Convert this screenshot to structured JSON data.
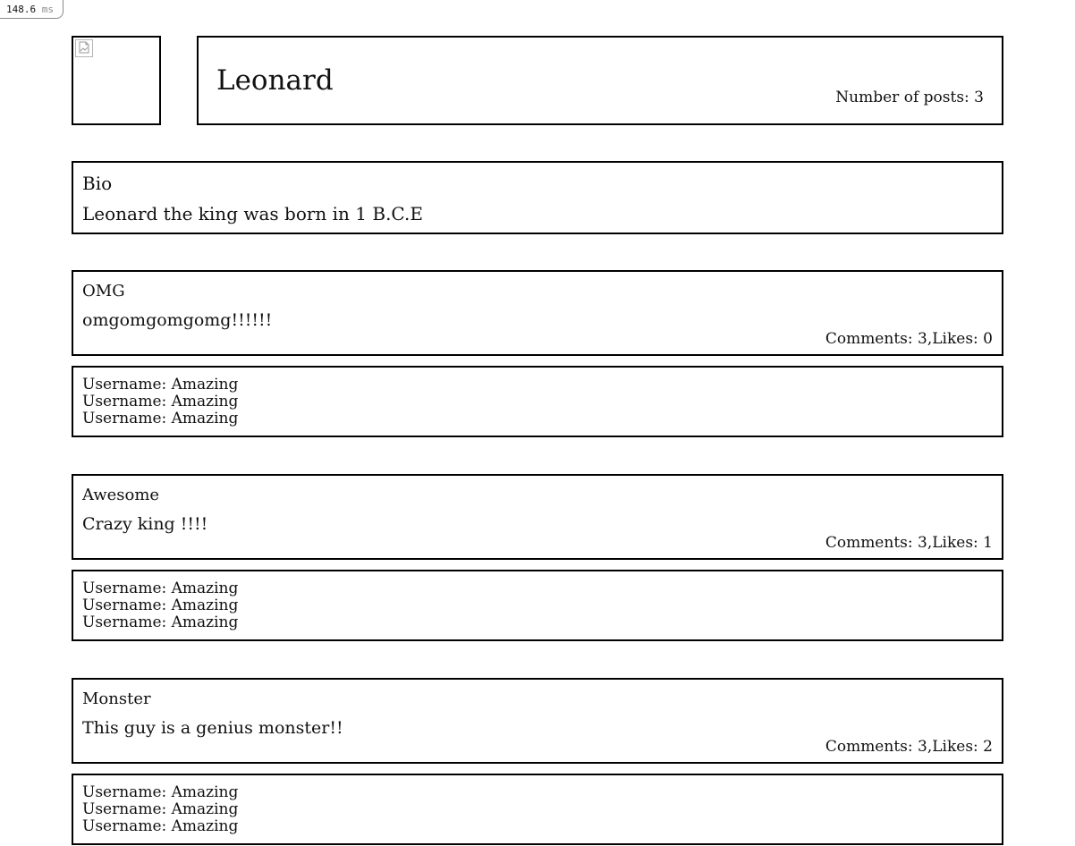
{
  "timing": {
    "value": "148.6",
    "unit": "ms"
  },
  "profile": {
    "avatar_icon": "broken-image-icon",
    "username": "Leonard",
    "post_count_label": "Number of posts: 3"
  },
  "bio": {
    "title": "Bio",
    "text": "Leonard the king was born in 1 B.C.E"
  },
  "posts": [
    {
      "title": "OMG",
      "body": "omgomgomgomg!!!!!!",
      "stats": "Comments: 3,Likes: 0",
      "comments": [
        "Username: Amazing",
        "Username: Amazing",
        "Username: Amazing"
      ]
    },
    {
      "title": "Awesome",
      "body": "Crazy king !!!!",
      "stats": "Comments: 3,Likes: 1",
      "comments": [
        "Username: Amazing",
        "Username: Amazing",
        "Username: Amazing"
      ]
    },
    {
      "title": "Monster",
      "body": "This guy is a genius monster!!",
      "stats": "Comments: 3,Likes: 2",
      "comments": [
        "Username: Amazing",
        "Username: Amazing",
        "Username: Amazing"
      ]
    }
  ]
}
